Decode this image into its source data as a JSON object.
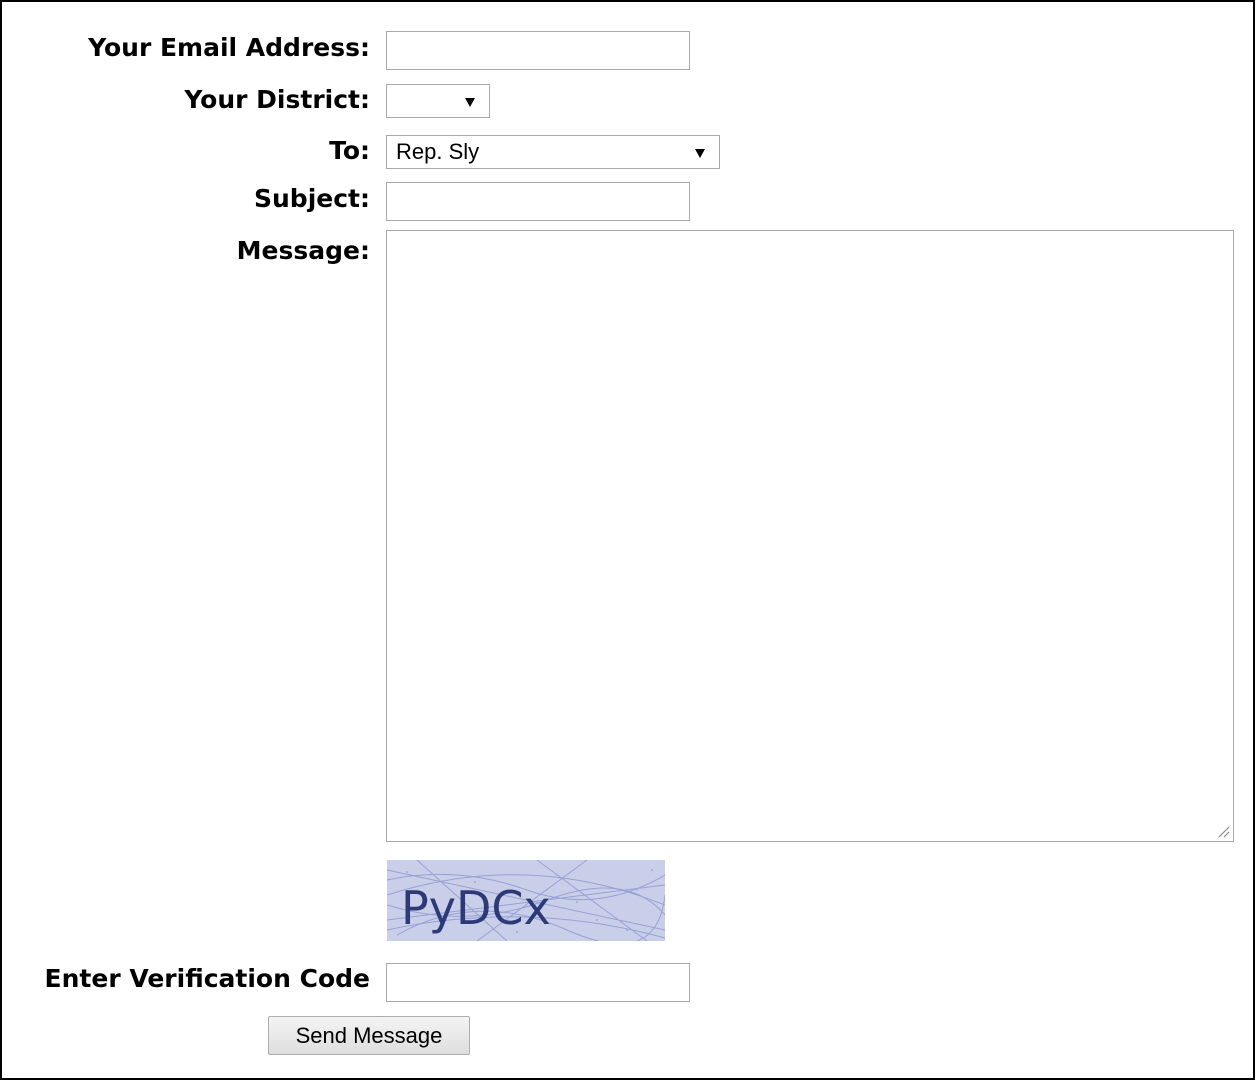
{
  "form": {
    "email_label": "Your Email Address:",
    "email_value": "",
    "district_label": "Your District:",
    "district_value": "",
    "to_label": "To:",
    "to_value": "Rep. Sly",
    "subject_label": "Subject:",
    "subject_value": "",
    "message_label": "Message:",
    "message_value": "",
    "captcha_code": "PyDCx",
    "verification_label": "Enter Verification Code",
    "verification_value": "",
    "send_label": "Send Message"
  },
  "icons": {
    "dropdown": "chevron-down-icon",
    "resize": "resize-grip-icon"
  },
  "colors": {
    "captcha_text": "#2e3a78",
    "captcha_bg": "#c9cfe9",
    "input_border": "#a9a9a9"
  }
}
